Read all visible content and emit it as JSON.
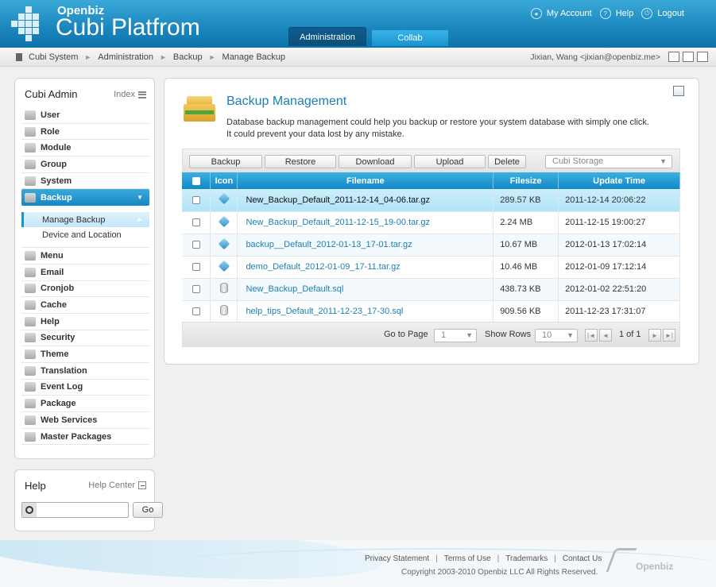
{
  "header": {
    "brand_small": "Openbiz",
    "brand_big": "Cubi Platfrom",
    "links": [
      {
        "label": "My Account",
        "icon": "user-icon"
      },
      {
        "label": "Help",
        "icon": "help-icon"
      },
      {
        "label": "Logout",
        "icon": "power-icon"
      }
    ],
    "tabs": [
      {
        "label": "Administration",
        "active": true
      },
      {
        "label": "Collab",
        "active": false
      }
    ]
  },
  "breadcrumb": {
    "items": [
      "Cubi System",
      "Administration",
      "Backup",
      "Manage Backup"
    ],
    "user": "Jixian, Wang <jixian@openbiz.me>"
  },
  "sidebar": {
    "title": "Cubi Admin",
    "index_label": "Index",
    "items_top": [
      {
        "label": "User",
        "icon": "user-icon"
      },
      {
        "label": "Role",
        "icon": "key-icon"
      },
      {
        "label": "Module",
        "icon": "module-icon"
      },
      {
        "label": "Group",
        "icon": "group-icon"
      },
      {
        "label": "System",
        "icon": "gear-icon"
      },
      {
        "label": "Backup",
        "icon": "backup-icon",
        "active": true
      }
    ],
    "sub_items": [
      {
        "label": "Manage Backup",
        "active": true
      },
      {
        "label": "Device and Location",
        "active": false
      }
    ],
    "items_bottom": [
      {
        "label": "Menu",
        "icon": "menu-icon"
      },
      {
        "label": "Email",
        "icon": "email-icon"
      },
      {
        "label": "Cronjob",
        "icon": "clock-icon"
      },
      {
        "label": "Cache",
        "icon": "cache-icon"
      },
      {
        "label": "Help",
        "icon": "help-icon"
      },
      {
        "label": "Security",
        "icon": "shield-icon"
      },
      {
        "label": "Theme",
        "icon": "theme-icon"
      },
      {
        "label": "Translation",
        "icon": "translation-icon"
      },
      {
        "label": "Event Log",
        "icon": "log-icon"
      },
      {
        "label": "Package",
        "icon": "package-icon"
      },
      {
        "label": "Web Services",
        "icon": "web-services-icon"
      },
      {
        "label": "Master Packages",
        "icon": "master-packages-icon"
      }
    ]
  },
  "help": {
    "title": "Help",
    "center_label": "Help Center",
    "search_placeholder": "",
    "go_label": "Go"
  },
  "main": {
    "title": "Backup Management",
    "desc_line1": "Database backup management could help you backup or restore your system database with simply one click.",
    "desc_line2": "It could prevent your data lost by any mistake.",
    "buttons": [
      "Backup",
      "Restore",
      "Download",
      "Upload",
      "Delete"
    ],
    "storage_select": "Cubi Storage",
    "columns": {
      "icon": "Icon",
      "filename": "Filename",
      "filesize": "Filesize",
      "update": "Update Time"
    },
    "rows": [
      {
        "icon": "package-icon",
        "filename": "New_Backup_Default_2011-12-14_04-06.tar.gz",
        "filesize": "289.57 KB",
        "update": "2011-12-14 20:06:22",
        "selected": true
      },
      {
        "icon": "package-icon",
        "filename": "New_Backup_Default_2011-12-15_19-00.tar.gz",
        "filesize": "2.24 MB",
        "update": "2011-12-15 19:00:27"
      },
      {
        "icon": "package-icon",
        "filename": "backup__Default_2012-01-13_17-01.tar.gz",
        "filesize": "10.67 MB",
        "update": "2012-01-13 17:02:14"
      },
      {
        "icon": "package-icon",
        "filename": "demo_Default_2012-01-09_17-11.tar.gz",
        "filesize": "10.46 MB",
        "update": "2012-01-09 17:12:14"
      },
      {
        "icon": "database-icon",
        "filename": "New_Backup_Default.sql",
        "filesize": "438.73 KB",
        "update": "2012-01-02 22:51:20"
      },
      {
        "icon": "database-icon",
        "filename": "help_tips_Default_2011-12-23_17-30.sql",
        "filesize": "909.56 KB",
        "update": "2011-12-23 17:31:07"
      }
    ],
    "pager": {
      "goto_label": "Go to Page",
      "goto_value": "1",
      "rows_label": "Show Rows",
      "rows_value": "10",
      "page_info": "1 of 1"
    }
  },
  "footer": {
    "links": [
      "Privacy Statement",
      "Terms of Use",
      "Trademarks",
      "Contact Us"
    ],
    "copyright": "Copyright 2003-2010 Openbiz LLC All Rights Reserved.",
    "logo_text": "Openbiz"
  }
}
